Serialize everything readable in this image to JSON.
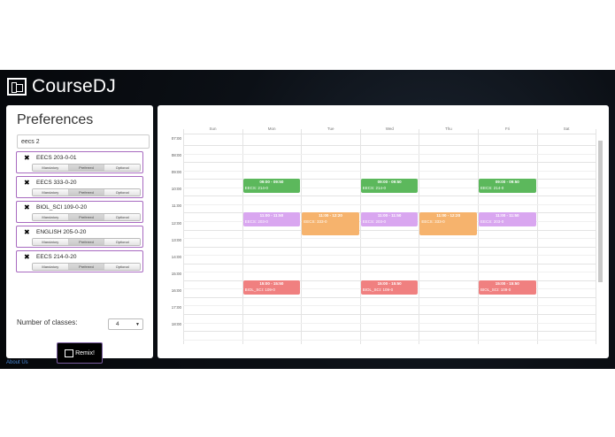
{
  "app": {
    "name": "CourseDJ"
  },
  "preferences": {
    "title": "Preferences",
    "search_value": "eecs 2",
    "courses": [
      {
        "name": "EECS 203-0-01"
      },
      {
        "name": "EECS 333-0-20"
      },
      {
        "name": "BIOL_SCI 109-0-20"
      },
      {
        "name": "ENGLISH 205-0-20"
      },
      {
        "name": "EECS 214-0-20"
      }
    ],
    "options": [
      "Mandatory",
      "Preferred",
      "Optional"
    ],
    "num_classes_label": "Number of classes:",
    "num_classes_value": "4",
    "remix_label": "Remix!"
  },
  "calendar": {
    "days": [
      "Sun",
      "Mon",
      "Tue",
      "Wed",
      "Thu",
      "Fri",
      "Sat"
    ],
    "times": [
      "07:00",
      "08:00",
      "09:00",
      "10:00",
      "11:00",
      "12:00",
      "13:00",
      "14:00",
      "15:00",
      "16:00",
      "17:00",
      "18:00"
    ],
    "events": [
      {
        "day": 1,
        "time": "09:00 - 09:50",
        "course": "EECS: 214-0",
        "color": "#5cb85c"
      },
      {
        "day": 3,
        "time": "09:00 - 09:50",
        "course": "EECS: 214-0",
        "color": "#5cb85c"
      },
      {
        "day": 5,
        "time": "09:00 - 09:50",
        "course": "EECS: 214-0",
        "color": "#5cb85c"
      },
      {
        "day": 1,
        "time": "11:00 - 11:50",
        "course": "EECS: 203-0",
        "color": "#d9a6f0"
      },
      {
        "day": 2,
        "time": "11:00 - 12:20",
        "course": "EECS: 333-0",
        "color": "#f6b36d"
      },
      {
        "day": 3,
        "time": "11:00 - 11:50",
        "course": "EECS: 203-0",
        "color": "#d9a6f0"
      },
      {
        "day": 4,
        "time": "11:00 - 12:20",
        "course": "EECS: 333-0",
        "color": "#f6b36d"
      },
      {
        "day": 5,
        "time": "11:00 - 11:50",
        "course": "EECS: 203-0",
        "color": "#d9a6f0"
      },
      {
        "day": 1,
        "time": "15:00 - 15:50",
        "course": "BIOL_SCI: 109-0",
        "color": "#f08080"
      },
      {
        "day": 3,
        "time": "15:00 - 15:50",
        "course": "BIOL_SCI: 109-0",
        "color": "#f08080"
      },
      {
        "day": 5,
        "time": "15:00 - 15:50",
        "course": "BIOL_SCI: 109-0",
        "color": "#f08080"
      }
    ]
  },
  "footer": {
    "about_label": "About Us"
  }
}
